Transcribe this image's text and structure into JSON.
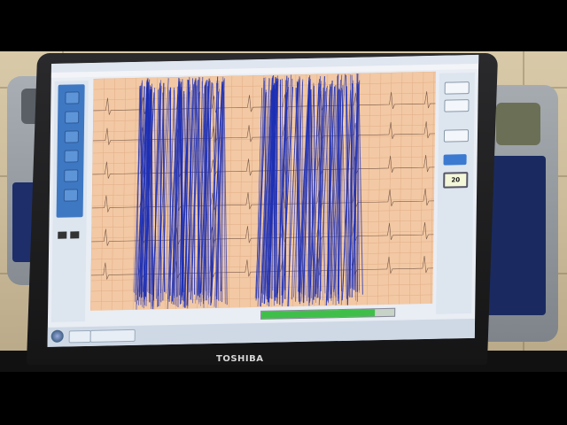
{
  "photo": {
    "description_kind": "photo",
    "laptop_brand": "TOSHIBA",
    "screen": {
      "right_panel_value": "20",
      "taskbar_item": "",
      "progress_fraction": 0.85
    }
  },
  "colors": {
    "wall": "#cdbd9c",
    "ecg_paper": "#f2c9a4",
    "trace": "#1c2fb5",
    "progress": "#3fbf4a",
    "ui_blue": "#3f78c2"
  }
}
